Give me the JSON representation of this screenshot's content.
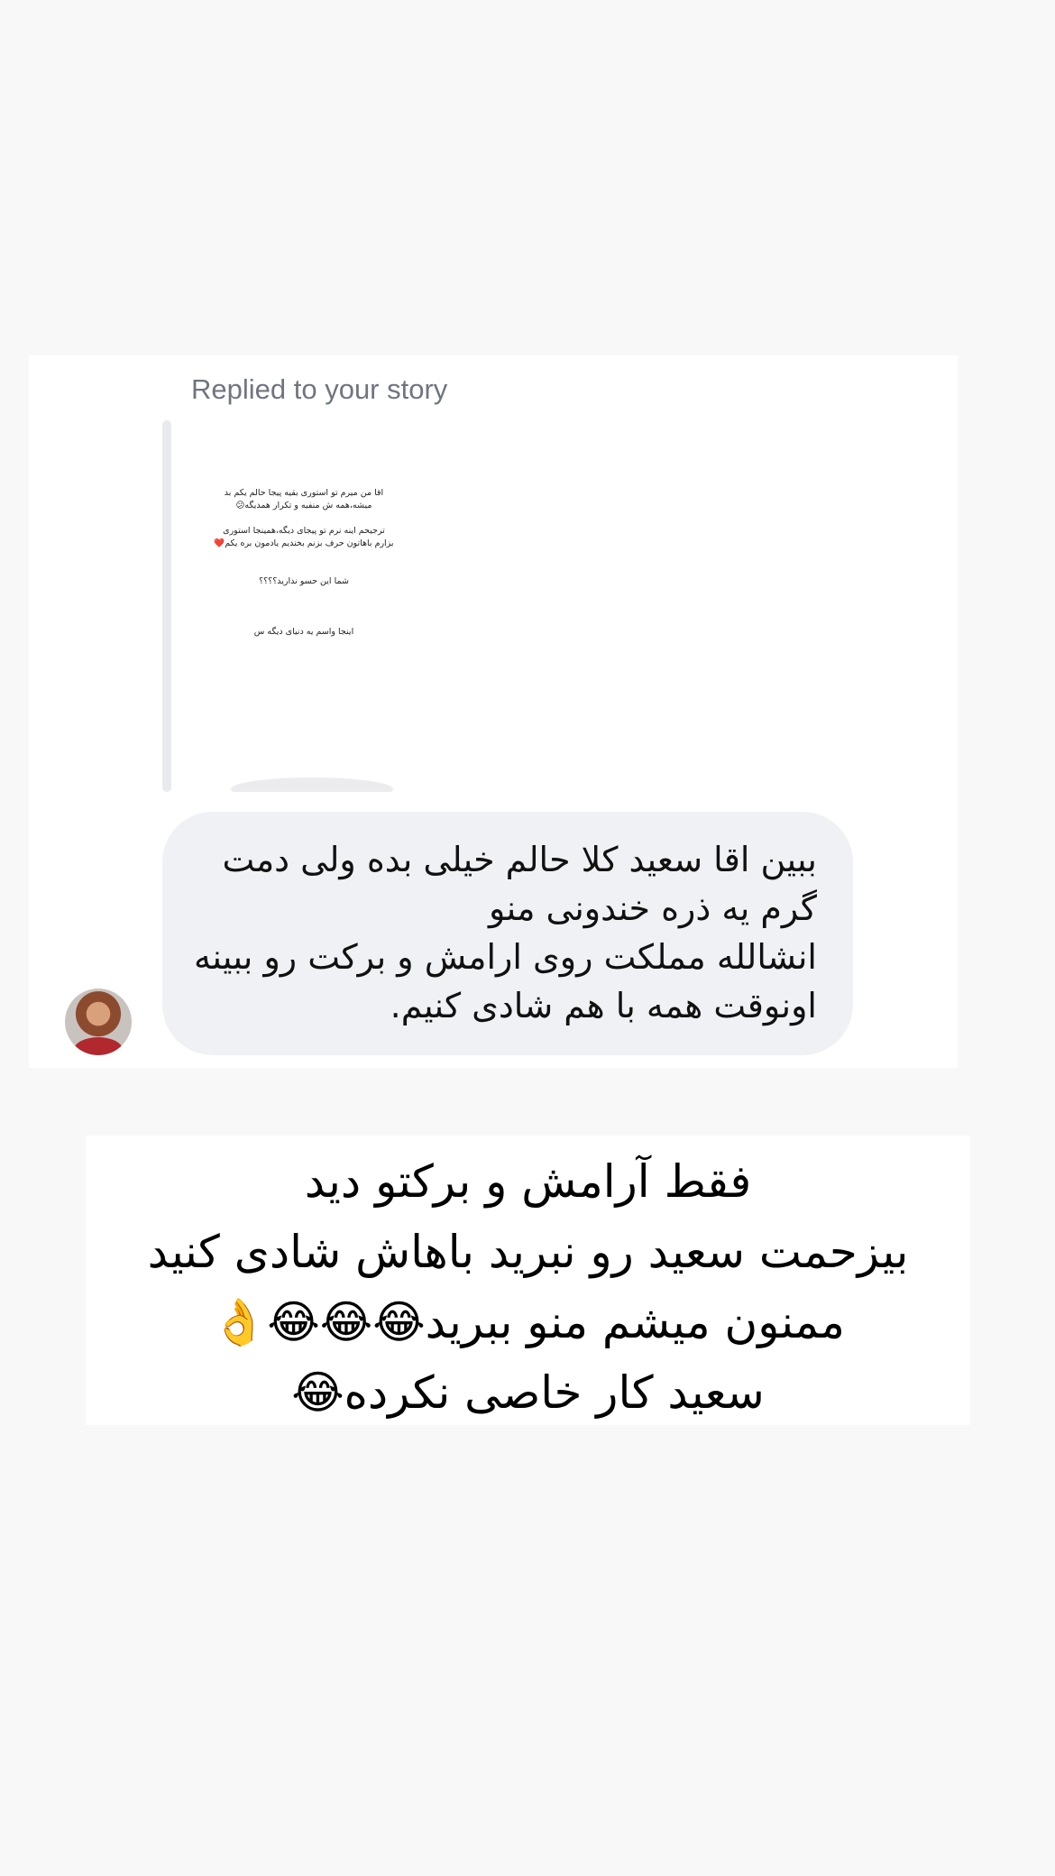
{
  "reply": {
    "label": "Replied to your story"
  },
  "story_preview": {
    "lines": [
      "اقا من میرم تو استوری بقیه پیجا حالم یکم بد",
      "میشه،همه ش منفیه و تکرار همدیگه😕",
      "ترجیحم اینه نرم تو پیجای دیگه،همینجا استوری",
      "بزارم باهاتون حرف بزنم بخندیم یادمون بره یکم❤️",
      "شما این حسو ندارید؟؟؟؟",
      "اینجا واسم یه دنیای دیگه س"
    ]
  },
  "message": {
    "lines": [
      "ببین اقا سعید کلا حالم خیلی بده ولی دمت",
      "گرم یه ذره خندونی منو",
      "انشالله مملکت روی ارامش و برکت رو ببینه",
      "اونوقت همه با هم شادی کنیم."
    ]
  },
  "caption": {
    "lines": [
      "فقط آرامش و برکتو دید",
      "بیزحمت سعید رو نبرید باهاش شادی کنید",
      "ممنون میشم منو ببرید😂😂😂👌",
      "سعید کار خاصی نکرده😂"
    ]
  }
}
